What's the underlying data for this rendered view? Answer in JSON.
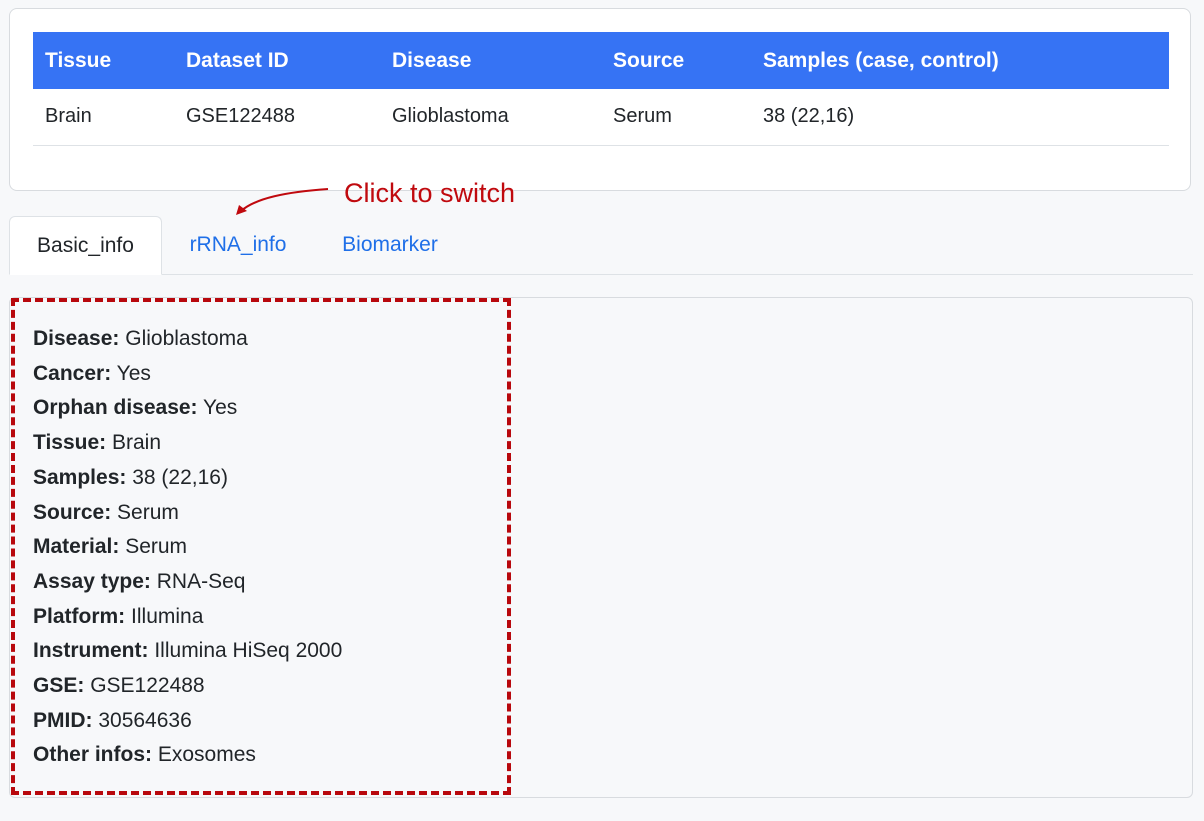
{
  "table": {
    "headers": [
      "Tissue",
      "Dataset ID",
      "Disease",
      "Source",
      "Samples (case, control)"
    ],
    "rows": [
      [
        "Brain",
        "GSE122488",
        "Glioblastoma",
        "Serum",
        "38 (22,16)"
      ]
    ]
  },
  "annotation": {
    "text": "Click to switch",
    "color": "#c0090e"
  },
  "tabs": [
    {
      "label": "Basic_info",
      "active": true
    },
    {
      "label": "rRNA_info",
      "active": false
    },
    {
      "label": "Biomarker",
      "active": false
    }
  ],
  "info": [
    {
      "label": "Disease:",
      "value": "Glioblastoma"
    },
    {
      "label": "Cancer:",
      "value": "Yes"
    },
    {
      "label": "Orphan disease:",
      "value": "Yes"
    },
    {
      "label": "Tissue:",
      "value": "Brain"
    },
    {
      "label": "Samples:",
      "value": "38 (22,16)"
    },
    {
      "label": "Source:",
      "value": "Serum"
    },
    {
      "label": "Material:",
      "value": "Serum"
    },
    {
      "label": "Assay type:",
      "value": "RNA-Seq"
    },
    {
      "label": "Platform:",
      "value": "Illumina"
    },
    {
      "label": "Instrument:",
      "value": "Illumina HiSeq 2000"
    },
    {
      "label": "GSE:",
      "value": "GSE122488"
    },
    {
      "label": "PMID:",
      "value": "30564636"
    },
    {
      "label": "Other infos:",
      "value": "Exosomes"
    }
  ],
  "colors": {
    "table_header": "#3673f4",
    "tab_link": "#1f6fe8",
    "highlight": "#b8080d"
  }
}
